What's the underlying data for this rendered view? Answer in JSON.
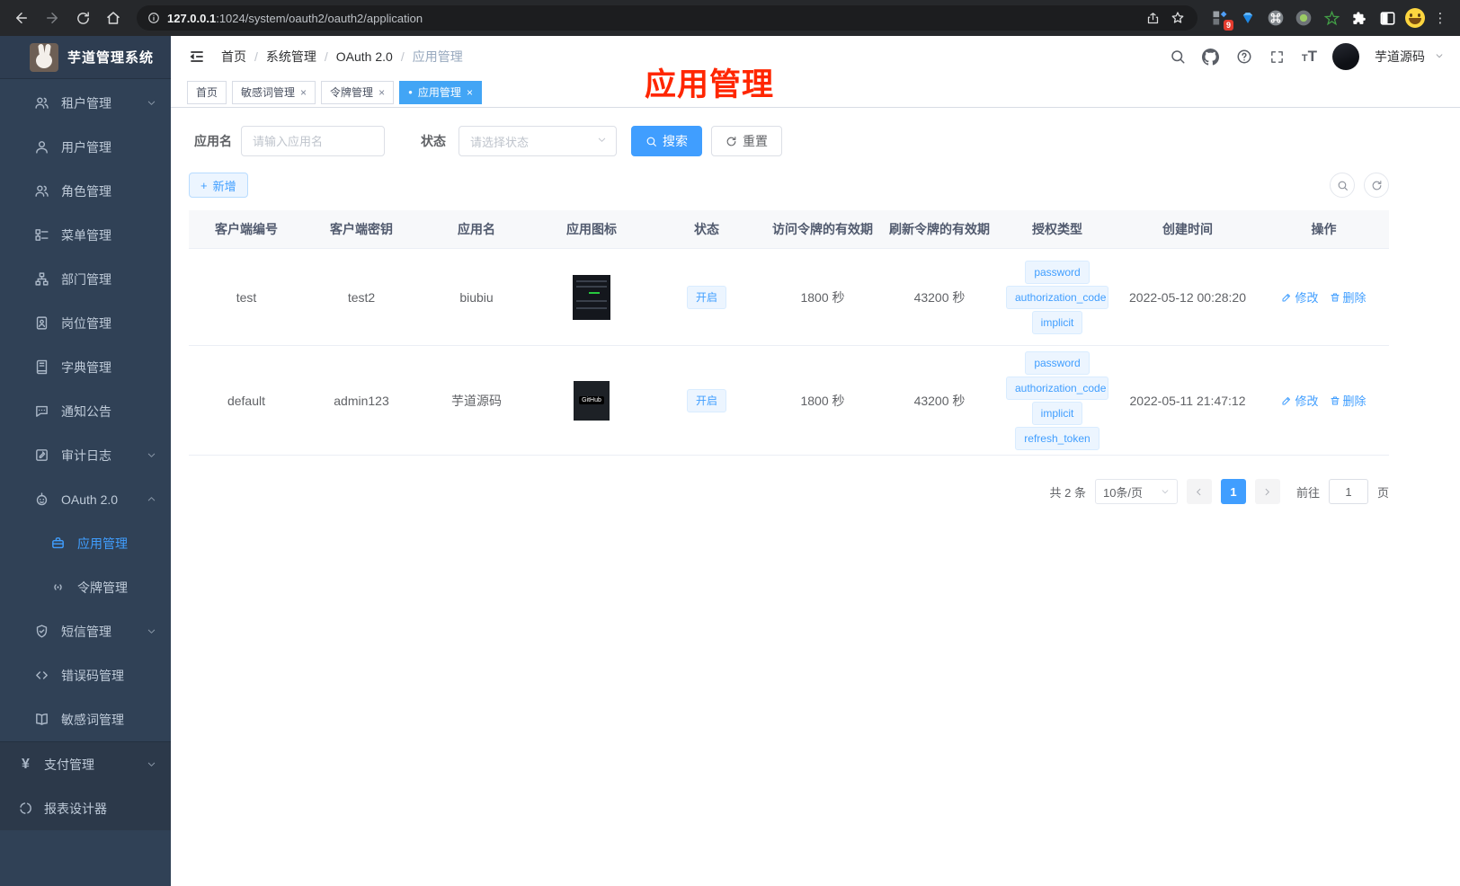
{
  "browser": {
    "url_host": "127.0.0.1",
    "url_path": ":1024/system/oauth2/oauth2/application",
    "ext_badge": "9"
  },
  "sidebar": {
    "logo_title": "芋道管理系统",
    "items": [
      {
        "label": "租户管理"
      },
      {
        "label": "用户管理"
      },
      {
        "label": "角色管理"
      },
      {
        "label": "菜单管理"
      },
      {
        "label": "部门管理"
      },
      {
        "label": "岗位管理"
      },
      {
        "label": "字典管理"
      },
      {
        "label": "通知公告"
      },
      {
        "label": "审计日志"
      },
      {
        "label": "OAuth 2.0"
      },
      {
        "label": "应用管理"
      },
      {
        "label": "令牌管理"
      },
      {
        "label": "短信管理"
      },
      {
        "label": "错误码管理"
      },
      {
        "label": "敏感词管理"
      },
      {
        "label": "支付管理"
      },
      {
        "label": "报表设计器"
      }
    ]
  },
  "header": {
    "breadcrumb": [
      "首页",
      "系统管理",
      "OAuth 2.0",
      "应用管理"
    ],
    "username": "芋道源码"
  },
  "tabs": [
    {
      "label": "首页"
    },
    {
      "label": "敏感词管理"
    },
    {
      "label": "令牌管理"
    },
    {
      "label": "应用管理"
    }
  ],
  "annotation": {
    "text": "应用管理",
    "color": "#ff2600"
  },
  "filter": {
    "name_label": "应用名",
    "name_placeholder": "请输入应用名",
    "status_label": "状态",
    "status_placeholder": "请选择状态",
    "search_label": "搜索",
    "reset_label": "重置"
  },
  "toolbar": {
    "add_label": "新增"
  },
  "table": {
    "columns": [
      "客户端编号",
      "客户端密钥",
      "应用名",
      "应用图标",
      "状态",
      "访问令牌的有效期",
      "刷新令牌的有效期",
      "授权类型",
      "创建时间",
      "操作"
    ],
    "rows": [
      {
        "client_id": "test",
        "secret": "test2",
        "name": "biubiu",
        "status": "开启",
        "access_ttl": "1800 秒",
        "refresh_ttl": "43200 秒",
        "grant_types": [
          "password",
          "authorization_code",
          "implicit"
        ],
        "created": "2022-05-12 00:28:20",
        "edit_label": "修改",
        "delete_label": "删除"
      },
      {
        "client_id": "default",
        "secret": "admin123",
        "name": "芋道源码",
        "icon_text": "GitHub",
        "status": "开启",
        "access_ttl": "1800 秒",
        "refresh_ttl": "43200 秒",
        "grant_types": [
          "password",
          "authorization_code",
          "implicit",
          "refresh_token"
        ],
        "created": "2022-05-11 21:47:12",
        "edit_label": "修改",
        "delete_label": "删除"
      }
    ]
  },
  "pagination": {
    "total": "共 2 条",
    "page_size": "10条/页",
    "current_page": "1",
    "goto_label": "前往",
    "goto_value": "1",
    "page_suffix": "页"
  },
  "glyphs": {
    "close": "×",
    "active_dot": "●",
    "slash": "/",
    "plus": "+",
    "yen": "¥",
    "kebab": "⋮",
    "font_small": "T",
    "font_big": "T",
    "question": "?"
  },
  "colors": {
    "accent": "#409eff",
    "sidebar_bg": "#304156",
    "annotation": "#ff2600",
    "tab_active": "#42a5f5"
  }
}
